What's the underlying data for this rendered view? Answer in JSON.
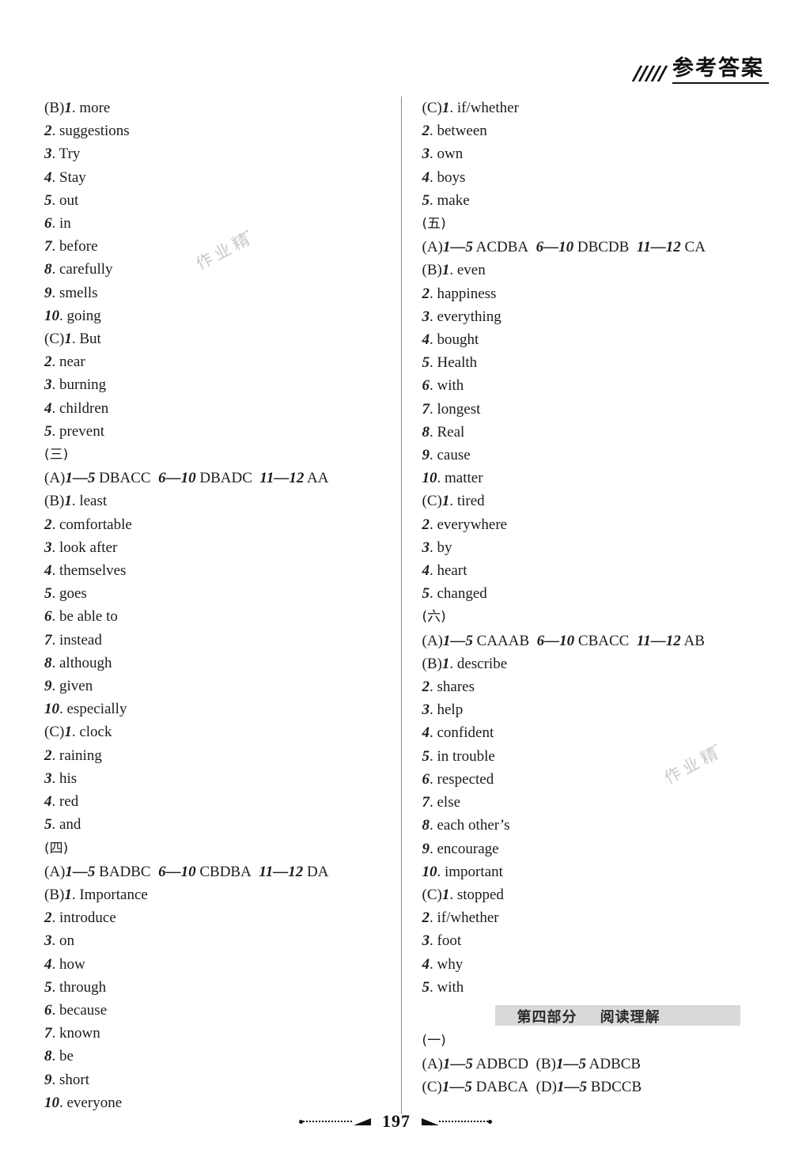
{
  "header": {
    "title": "参考答案",
    "slash_count": 5
  },
  "watermark": {
    "text": "作业精፝"
  },
  "footer": {
    "page_number": "197"
  },
  "columns": {
    "left": [
      {
        "label": "(B)",
        "num": "1",
        "text": ". more"
      },
      {
        "num": "2",
        "text": ". suggestions"
      },
      {
        "num": "3",
        "text": ". Try"
      },
      {
        "num": "4",
        "text": ". Stay"
      },
      {
        "num": "5",
        "text": ". out"
      },
      {
        "num": "6",
        "text": ". in"
      },
      {
        "num": "7",
        "text": ". before"
      },
      {
        "num": "8",
        "text": ". carefully"
      },
      {
        "num": "9",
        "text": ". smells"
      },
      {
        "num": "10",
        "text": ". going"
      },
      {
        "label": "(C)",
        "num": "1",
        "text": ". But"
      },
      {
        "num": "2",
        "text": ". near"
      },
      {
        "num": "3",
        "text": ". burning"
      },
      {
        "num": "4",
        "text": ". children"
      },
      {
        "num": "5",
        "text": ". prevent"
      },
      {
        "section": "(三)"
      },
      {
        "label": "(A)",
        "ranges": [
          {
            "range": "1—5",
            "answers": "DBACC"
          },
          {
            "range": "6—10",
            "answers": "DBADC"
          },
          {
            "range": "11—12",
            "answers": "AA"
          }
        ]
      },
      {
        "label": "(B)",
        "num": "1",
        "text": ". least"
      },
      {
        "num": "2",
        "text": ". comfortable"
      },
      {
        "num": "3",
        "text": ". look after"
      },
      {
        "num": "4",
        "text": ". themselves"
      },
      {
        "num": "5",
        "text": ". goes"
      },
      {
        "num": "6",
        "text": ". be able to"
      },
      {
        "num": "7",
        "text": ". instead"
      },
      {
        "num": "8",
        "text": ". although"
      },
      {
        "num": "9",
        "text": ". given"
      },
      {
        "num": "10",
        "text": ". especially"
      },
      {
        "label": "(C)",
        "num": "1",
        "text": ". clock"
      },
      {
        "num": "2",
        "text": ". raining"
      },
      {
        "num": "3",
        "text": ". his"
      },
      {
        "num": "4",
        "text": ". red"
      },
      {
        "num": "5",
        "text": ". and"
      },
      {
        "section": "(四)"
      },
      {
        "label": "(A)",
        "ranges": [
          {
            "range": "1—5",
            "answers": "BADBC"
          },
          {
            "range": "6—10",
            "answers": "CBDBA"
          },
          {
            "range": "11—12",
            "answers": "DA"
          }
        ]
      },
      {
        "label": "(B)",
        "num": "1",
        "text": ". Importance"
      },
      {
        "num": "2",
        "text": ". introduce"
      },
      {
        "num": "3",
        "text": ". on"
      },
      {
        "num": "4",
        "text": ". how"
      },
      {
        "num": "5",
        "text": ". through"
      },
      {
        "num": "6",
        "text": ". because"
      },
      {
        "num": "7",
        "text": ". known"
      },
      {
        "num": "8",
        "text": ". be"
      },
      {
        "num": "9",
        "text": ". short"
      },
      {
        "num": "10",
        "text": ". everyone"
      }
    ],
    "right": [
      {
        "label": "(C)",
        "num": "1",
        "text": ". if/whether"
      },
      {
        "num": "2",
        "text": ". between"
      },
      {
        "num": "3",
        "text": ". own"
      },
      {
        "num": "4",
        "text": ". boys"
      },
      {
        "num": "5",
        "text": ". make"
      },
      {
        "section": "(五)"
      },
      {
        "label": "(A)",
        "ranges": [
          {
            "range": "1—5",
            "answers": "ACDBA"
          },
          {
            "range": "6—10",
            "answers": "DBCDB"
          },
          {
            "range": "11—12",
            "answers": "CA"
          }
        ]
      },
      {
        "label": "(B)",
        "num": "1",
        "text": ". even"
      },
      {
        "num": "2",
        "text": ". happiness"
      },
      {
        "num": "3",
        "text": ". everything"
      },
      {
        "num": "4",
        "text": ". bought"
      },
      {
        "num": "5",
        "text": ". Health"
      },
      {
        "num": "6",
        "text": ". with"
      },
      {
        "num": "7",
        "text": ". longest"
      },
      {
        "num": "8",
        "text": ". Real"
      },
      {
        "num": "9",
        "text": ". cause"
      },
      {
        "num": "10",
        "text": ". matter"
      },
      {
        "label": "(C)",
        "num": "1",
        "text": ". tired"
      },
      {
        "num": "2",
        "text": ". everywhere"
      },
      {
        "num": "3",
        "text": ". by"
      },
      {
        "num": "4",
        "text": ". heart"
      },
      {
        "num": "5",
        "text": ". changed"
      },
      {
        "section": "(六)"
      },
      {
        "label": "(A)",
        "ranges": [
          {
            "range": "1—5",
            "answers": "CAAAB"
          },
          {
            "range": "6—10",
            "answers": "CBACC"
          },
          {
            "range": "11—12",
            "answers": "AB"
          }
        ]
      },
      {
        "label": "(B)",
        "num": "1",
        "text": ". describe"
      },
      {
        "num": "2",
        "text": ". shares"
      },
      {
        "num": "3",
        "text": ". help"
      },
      {
        "num": "4",
        "text": ". confident"
      },
      {
        "num": "5",
        "text": ". in trouble"
      },
      {
        "num": "6",
        "text": ". respected"
      },
      {
        "num": "7",
        "text": ". else"
      },
      {
        "num": "8",
        "text": ". each other’s"
      },
      {
        "num": "9",
        "text": ". encourage"
      },
      {
        "num": "10",
        "text": ". important"
      },
      {
        "label": "(C)",
        "num": "1",
        "text": ". stopped"
      },
      {
        "num": "2",
        "text": ". if/whether"
      },
      {
        "num": "3",
        "text": ". foot"
      },
      {
        "num": "4",
        "text": ". why"
      },
      {
        "num": "5",
        "text": ". with"
      },
      {
        "banner": "第四部分    阅读理解"
      },
      {
        "section": "(一)"
      },
      {
        "label": "(A)",
        "ranges": [
          {
            "range": "1—5",
            "answers": "ADBCD"
          }
        ],
        "label2": "(B)",
        "ranges2": [
          {
            "range": "1—5",
            "answers": "ADBCB"
          }
        ]
      },
      {
        "label": "(C)",
        "ranges": [
          {
            "range": "1—5",
            "answers": "DABCA"
          }
        ],
        "label2": "(D)",
        "ranges2": [
          {
            "range": "1—5",
            "answers": "BDCCB"
          }
        ]
      }
    ]
  }
}
